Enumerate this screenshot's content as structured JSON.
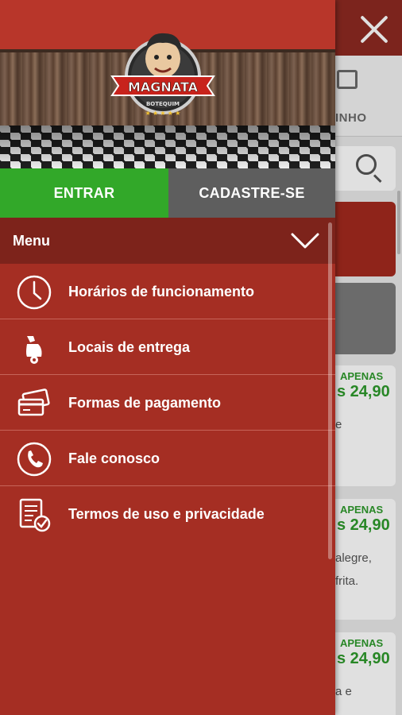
{
  "background": {
    "tab_label": "INHO",
    "cards": [
      {
        "apenas": "APENAS",
        "price": "s 24,90",
        "desc": [
          "e"
        ]
      },
      {
        "apenas": "APENAS",
        "price": "s 24,90",
        "desc": [
          "alegre,",
          "frita."
        ]
      },
      {
        "apenas": "APENAS",
        "price": "s 24,90",
        "desc": [
          "a e"
        ]
      }
    ]
  },
  "drawer": {
    "logo": {
      "text": "MAGNATA",
      "subtext": "BOTEQUIM"
    },
    "auth": {
      "login_label": "ENTRAR",
      "signup_label": "CADASTRE-SE"
    },
    "menu_header": {
      "title": "Menu"
    },
    "items": [
      {
        "label": "Horários de funcionamento",
        "icon": "clock-icon"
      },
      {
        "label": "Locais de entrega",
        "icon": "scooter-icon"
      },
      {
        "label": "Formas de pagamento",
        "icon": "credit-cards-icon"
      },
      {
        "label": "Fale conosco",
        "icon": "phone-icon"
      },
      {
        "label": "Termos de uso e privacidade",
        "icon": "document-check-icon"
      }
    ]
  },
  "colors": {
    "drawer_bg": "#a52e23",
    "menu_header_bg": "#7d231b",
    "login_green": "#32a829",
    "signup_gray": "#5e5e5e",
    "price_green": "#2e9a2c"
  }
}
